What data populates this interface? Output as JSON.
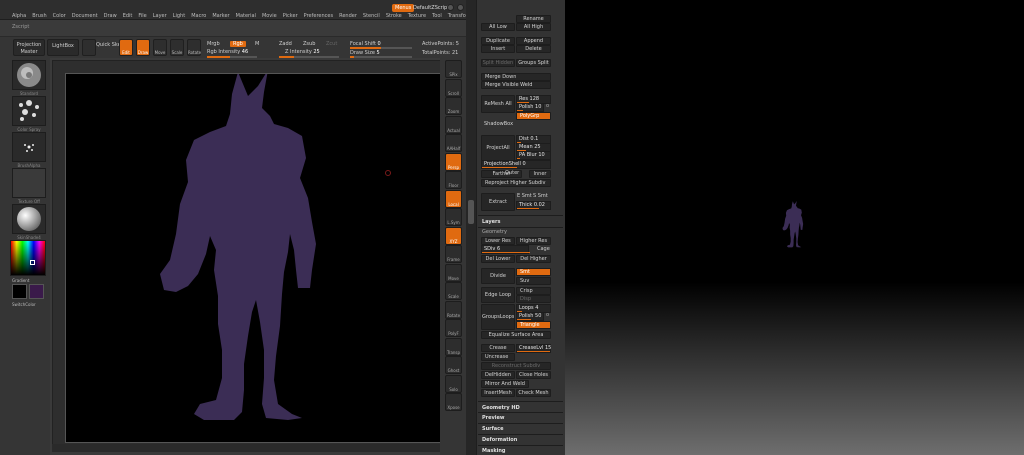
{
  "menubar": {
    "items": [
      "Alpha",
      "Brush",
      "Color",
      "Document",
      "Draw",
      "Edit",
      "File",
      "Layer",
      "Light",
      "Macro",
      "Marker",
      "Material",
      "Movie",
      "Picker",
      "Preferences",
      "Render",
      "Stencil",
      "Stroke",
      "Texture",
      "Tool",
      "Transform",
      "Zoom",
      "Zplugin"
    ],
    "script_label": "Zscript",
    "menus_button": "Menus",
    "script_name": "DefaultZScript"
  },
  "toolbar": {
    "projection_master": "Projection Master",
    "lightbox": "LightBox",
    "quick_sketch": "Quick Sketch",
    "edit": "Edit",
    "draw": "Draw",
    "move": "Move",
    "scale": "Scale",
    "rotate": "Rotate",
    "mrgb": "Mrgb",
    "rgb": "Rgb",
    "m": "M",
    "zadd": "Zadd",
    "zsub": "Zsub",
    "zcut": "Zcut",
    "rgb_intensity_label": "Rgb Intensity",
    "rgb_intensity_value": "46",
    "z_intensity_label": "Z Intensity",
    "z_intensity_value": "25",
    "focal_shift_label": "Focal Shift",
    "focal_shift_value": "0",
    "draw_size_label": "Draw Size",
    "draw_size_value": "5",
    "active_points_label": "ActivePoints:",
    "active_points_value": "5",
    "total_points_label": "TotalPoints:",
    "total_points_value": "21",
    "rgb_chip": "Rgb"
  },
  "left_shelf": {
    "brush_label": "Standard",
    "stroke_label": "Color Spray",
    "alpha_label": "BrushAlpha",
    "texture_label": "Texture Off",
    "material_label": "SkinShade4",
    "gradient_label": "Gradient",
    "switch_label": "SwitchColor"
  },
  "right_shelf": {
    "buttons": [
      "SPix",
      "Scroll",
      "Zoom",
      "Actual",
      "AAHalf",
      "Persp",
      "Floor",
      "Local",
      "L.Sym",
      "XYZ",
      "Frame",
      "Move",
      "Scale",
      "Rotate",
      "PolyF",
      "Transp",
      "Ghost",
      "Solo",
      "Xpose"
    ]
  },
  "tray": {
    "rename": "Rename",
    "all_low": "All Low",
    "all_high": "All High",
    "duplicate": "Duplicate",
    "append": "Append",
    "insert": "Insert",
    "delete": "Delete",
    "split_hidden": "Split Hidden",
    "groups_split": "Groups Split",
    "merge_down": "Merge Down",
    "merge_visible_weld": "Merge Visible Weld",
    "remesh_all": "ReMesh All",
    "res_label": "Res",
    "res_value": "128",
    "polish_label": "Polish",
    "polish_value": "10",
    "polygrp": "PolyGrp",
    "shadowbox": "ShadowBox",
    "project_all": "ProjectAll",
    "dist_label": "Dist",
    "dist_value": "0.1",
    "mean_label": "Mean",
    "mean_value": "25",
    "pa_blur_label": "PA Blur",
    "pa_blur_value": "10",
    "projection_shell_label": "ProjectionShell",
    "projection_shell_value": "0",
    "farther": "Farther",
    "outer": "Outer",
    "inner": "Inner",
    "reproject_higher": "Reproject Higher Subdiv",
    "extract": "Extract",
    "e_smt": "E Smt",
    "s_smt": "S Smt",
    "thick_label": "Thick",
    "thick_value": "0.02",
    "layers": "Layers",
    "geometry": "Geometry",
    "lower_res": "Lower Res",
    "higher_res": "Higher Res",
    "sdiv_label": "SDiv",
    "sdiv_value": "6",
    "cage": "Cage",
    "del_lower": "Del Lower",
    "del_higher": "Del Higher",
    "divide": "Divide",
    "smt": "Smt",
    "suv": "Suv",
    "edge_loop": "Edge Loop",
    "crisp": "Crisp",
    "disp": "Disp",
    "groups_loops": "GroupsLoops",
    "loops_label": "Loops",
    "loops_value": "4",
    "polish2_label": "Polish",
    "polish2_value": "50",
    "triangle": "Triangle",
    "equalize_surface_area": "Equalize Surface Area",
    "crease": "Crease",
    "crease_lvl_label": "CreaseLvl",
    "crease_lvl_value": "15",
    "uncrease": "Uncrease",
    "reconstruct_subdiv": "Reconstruct Subdiv",
    "del_hidden": "DelHidden",
    "close_holes": "Close Holes",
    "mirror_and_weld": "Mirror And Weld",
    "insert_mesh": "InsertMesh",
    "check_mesh": "Check Mesh",
    "geometry_hd": "Geometry HD",
    "preview": "Preview",
    "surface": "Surface",
    "deformation": "Deformation",
    "masking": "Masking"
  },
  "colors": {
    "accent": "#e06a10",
    "figure": "#3b2d55",
    "panel": "#333333",
    "canvas": "#000000"
  }
}
